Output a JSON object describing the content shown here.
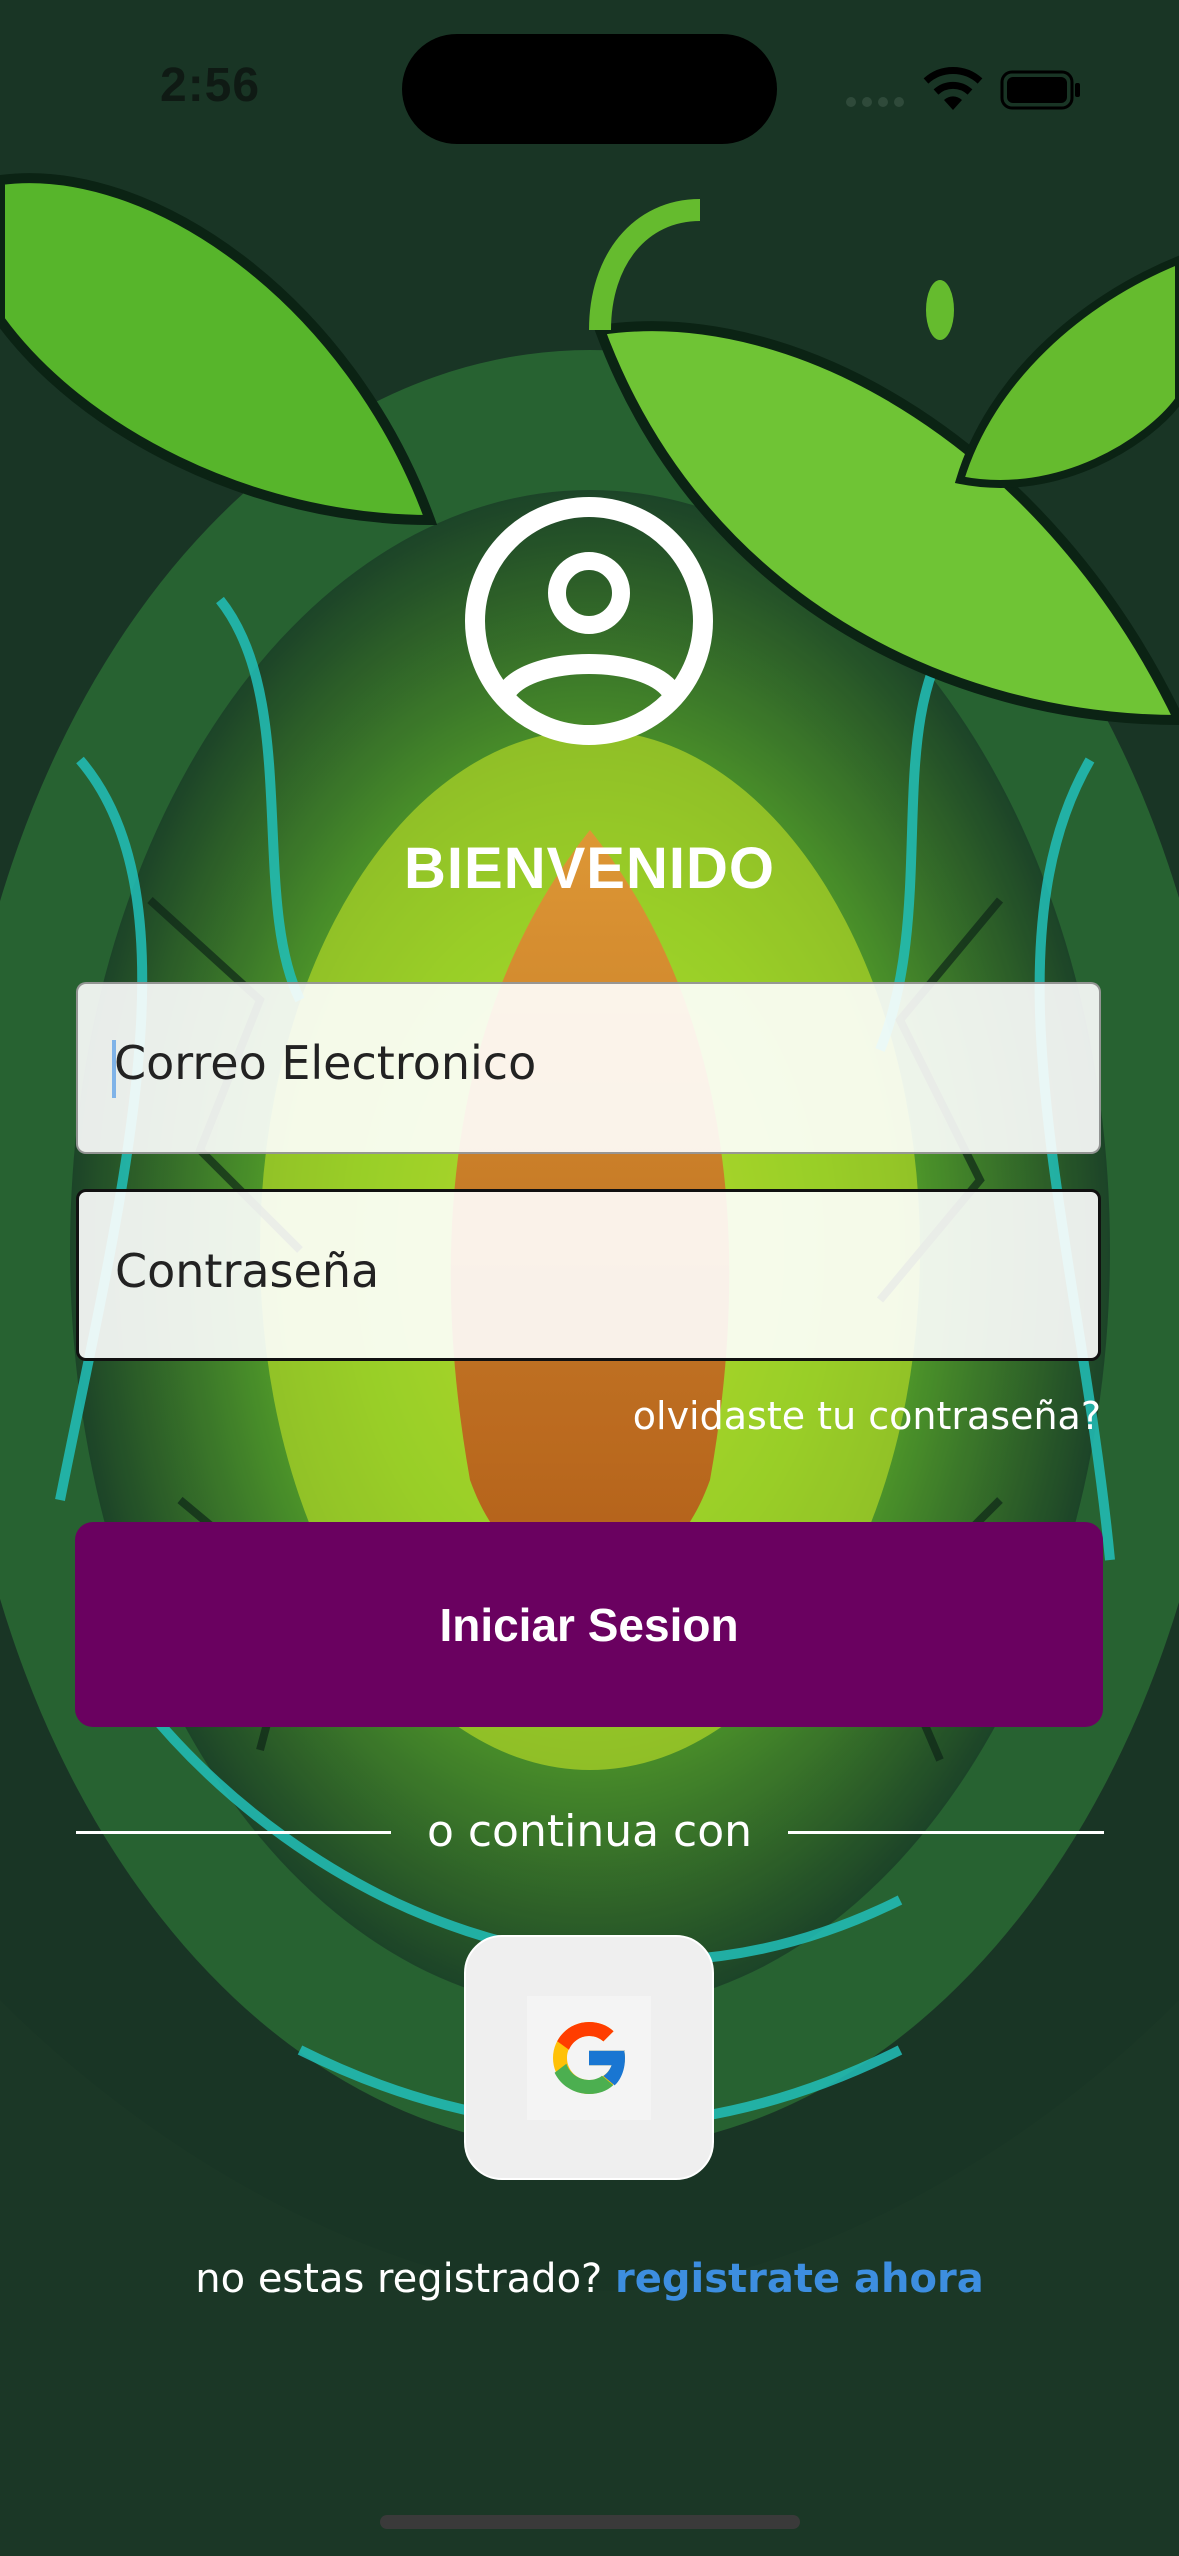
{
  "status_bar": {
    "time": "2:56"
  },
  "header": {
    "title": "BIENVENIDO"
  },
  "form": {
    "email_placeholder": "Correo Electronico",
    "password_placeholder": "Contraseña",
    "forgot_link": "olvidaste tu contraseña?",
    "login_button": "Iniciar Sesion"
  },
  "alt_login": {
    "divider_text": "o continua con"
  },
  "register": {
    "prompt": "no estas registrado?",
    "link": "registrate ahora"
  },
  "colors": {
    "primary_button": "#6a0160",
    "link": "#3d8ee0",
    "background": "#1d3a2a"
  }
}
